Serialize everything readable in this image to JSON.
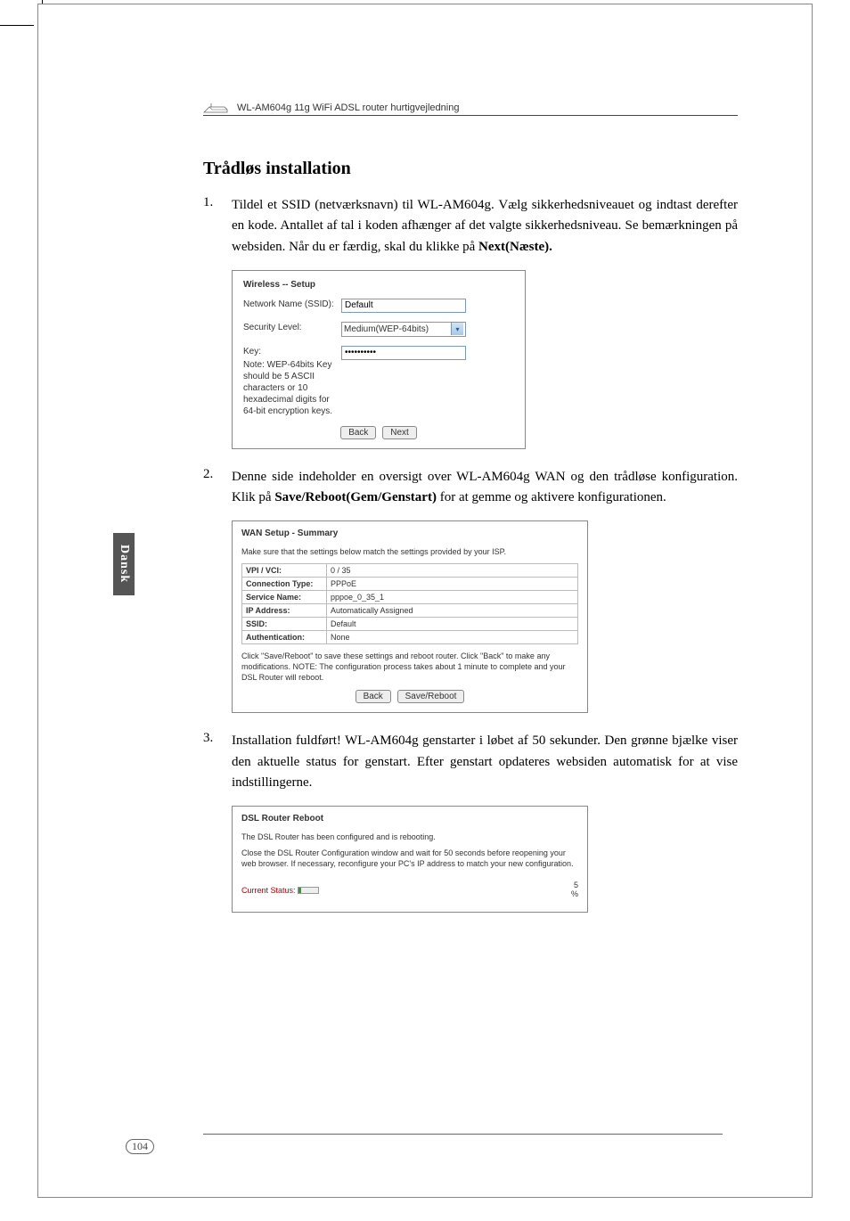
{
  "header": {
    "doc_title": "WL-AM604g 11g WiFi ADSL router hurtigvejledning"
  },
  "side_tab": "Dansk",
  "page_number": "104",
  "section": {
    "title": "Trådløs installation"
  },
  "steps": {
    "s1": {
      "num": "1.",
      "text_a": "Tildel et SSID (netværksnavn) til WL-AM604g. Vælg sikkerhedsniveauet og indtast derefter en kode. Antallet af tal i koden afhænger af det valgte sikkerhedsniveau. Se bemærkningen på websiden. Når du er færdig, skal du klikke på ",
      "bold": "Next(Næste)."
    },
    "s2": {
      "num": "2.",
      "text_a": "Denne side indeholder en oversigt over WL-AM604g WAN og den trådløse konfiguration. Klik på ",
      "bold": "Save/Reboot(Gem/Genstart)",
      "text_b": " for at gemme og aktivere konfigurationen."
    },
    "s3": {
      "num": "3.",
      "text_a": "Installation fuldført! WL-AM604g genstarter i løbet af 50 sekunder. Den grønne bjælke viser den aktuelle status for genstart. Efter genstart opdateres websiden automatisk for at vise indstillingerne."
    }
  },
  "panel1": {
    "title": "Wireless -- Setup",
    "ssid_label": "Network Name (SSID):",
    "ssid_value": "Default",
    "sec_label": "Security Level:",
    "sec_value": "Medium(WEP-64bits)",
    "key_label": "Key:",
    "key_value": "••••••••••",
    "note": "Note: WEP-64bits Key should be 5 ASCII characters or 10 hexadecimal digits for 64-bit encryption keys.",
    "btn_back": "Back",
    "btn_next": "Next"
  },
  "panel2": {
    "title": "WAN Setup - Summary",
    "subtitle": "Make sure that the settings below match the settings provided by your ISP.",
    "rows": {
      "r0": {
        "k": "VPI / VCI:",
        "v": "0 / 35"
      },
      "r1": {
        "k": "Connection Type:",
        "v": "PPPoE"
      },
      "r2": {
        "k": "Service Name:",
        "v": "pppoe_0_35_1"
      },
      "r3": {
        "k": "IP Address:",
        "v": "Automatically Assigned"
      },
      "r4": {
        "k": "SSID:",
        "v": "Default"
      },
      "r5": {
        "k": "Authentication:",
        "v": "None"
      }
    },
    "footnote": "Click \"Save/Reboot\" to save these settings and reboot router. Click \"Back\" to make any modifications.\nNOTE: The configuration process takes about 1 minute to complete and your DSL Router will reboot.",
    "btn_back": "Back",
    "btn_save": "Save/Reboot"
  },
  "panel3": {
    "title": "DSL Router Reboot",
    "subtitle": "The DSL Router has been configured and is rebooting.",
    "msg": "Close the DSL Router Configuration window and wait for 50 seconds before reopening your web browser. If necessary, reconfigure your PC's IP address to match your new configuration.",
    "status_label": "Current Status:",
    "percent": "5",
    "percent_sym": "%"
  }
}
